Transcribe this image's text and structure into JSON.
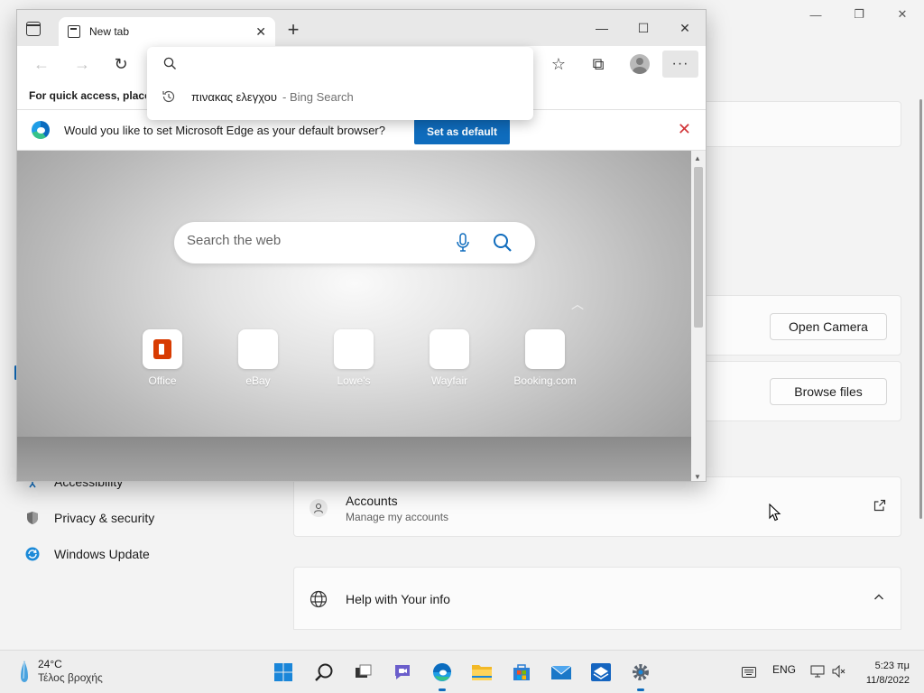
{
  "settings": {
    "caption": {
      "minimize": "—",
      "maximize": "❐",
      "close": "✕"
    },
    "buttons": {
      "open_camera": "Open Camera",
      "browse_files": "Browse files"
    },
    "sidebar": [
      {
        "label": "Accessibility",
        "icon": "accessibility-icon"
      },
      {
        "label": "Privacy & security",
        "icon": "shield-icon"
      },
      {
        "label": "Windows Update",
        "icon": "windows-update-icon"
      }
    ],
    "accounts": {
      "title": "Accounts",
      "subtitle": "Manage my accounts",
      "link_icon": "↗"
    },
    "help": {
      "title": "Help with Your info",
      "chevron": "⌃"
    }
  },
  "edge": {
    "tab": {
      "title": "New tab",
      "close": "✕"
    },
    "new_tab": "+",
    "caption": {
      "minimize": "—",
      "maximize": "☐",
      "close": "✕"
    },
    "toolbar": {
      "back": "←",
      "forward": "→",
      "refresh": "↻",
      "favorites": "☆",
      "collections": "⧉",
      "more": "···"
    },
    "favorites_bar": "For quick access, place y",
    "infobar": {
      "message": "Would you like to set Microsoft Edge as your default browser?",
      "button": "Set as default",
      "close": "✕"
    },
    "address_dropdown": {
      "value": "",
      "suggestion": {
        "query": "πινακας ελεγχου",
        "source": "- Bing Search"
      }
    },
    "ntp": {
      "search_placeholder": "Search the web",
      "collapse": "︿",
      "tiles": [
        {
          "label": "Office"
        },
        {
          "label": "eBay"
        },
        {
          "label": "Lowe's"
        },
        {
          "label": "Wayfair"
        },
        {
          "label": "Booking.com"
        }
      ]
    },
    "scrollbar": {
      "up": "▲",
      "down": "▼"
    }
  },
  "taskbar": {
    "weather": {
      "temp": "24°C",
      "desc": "Τέλος βροχής"
    },
    "apps": [
      "start-icon",
      "search-icon",
      "task-view-icon",
      "chat-icon",
      "edge-icon",
      "file-explorer-icon",
      "store-icon",
      "mail-icon",
      "app-icon",
      "settings-icon"
    ],
    "tray": {
      "language": "ENG"
    },
    "clock": {
      "time": "5:23 πμ",
      "date": "11/8/2022"
    }
  },
  "colors": {
    "accent": "#0f6cbd",
    "error": "#d13438",
    "office": "#d83b01"
  }
}
